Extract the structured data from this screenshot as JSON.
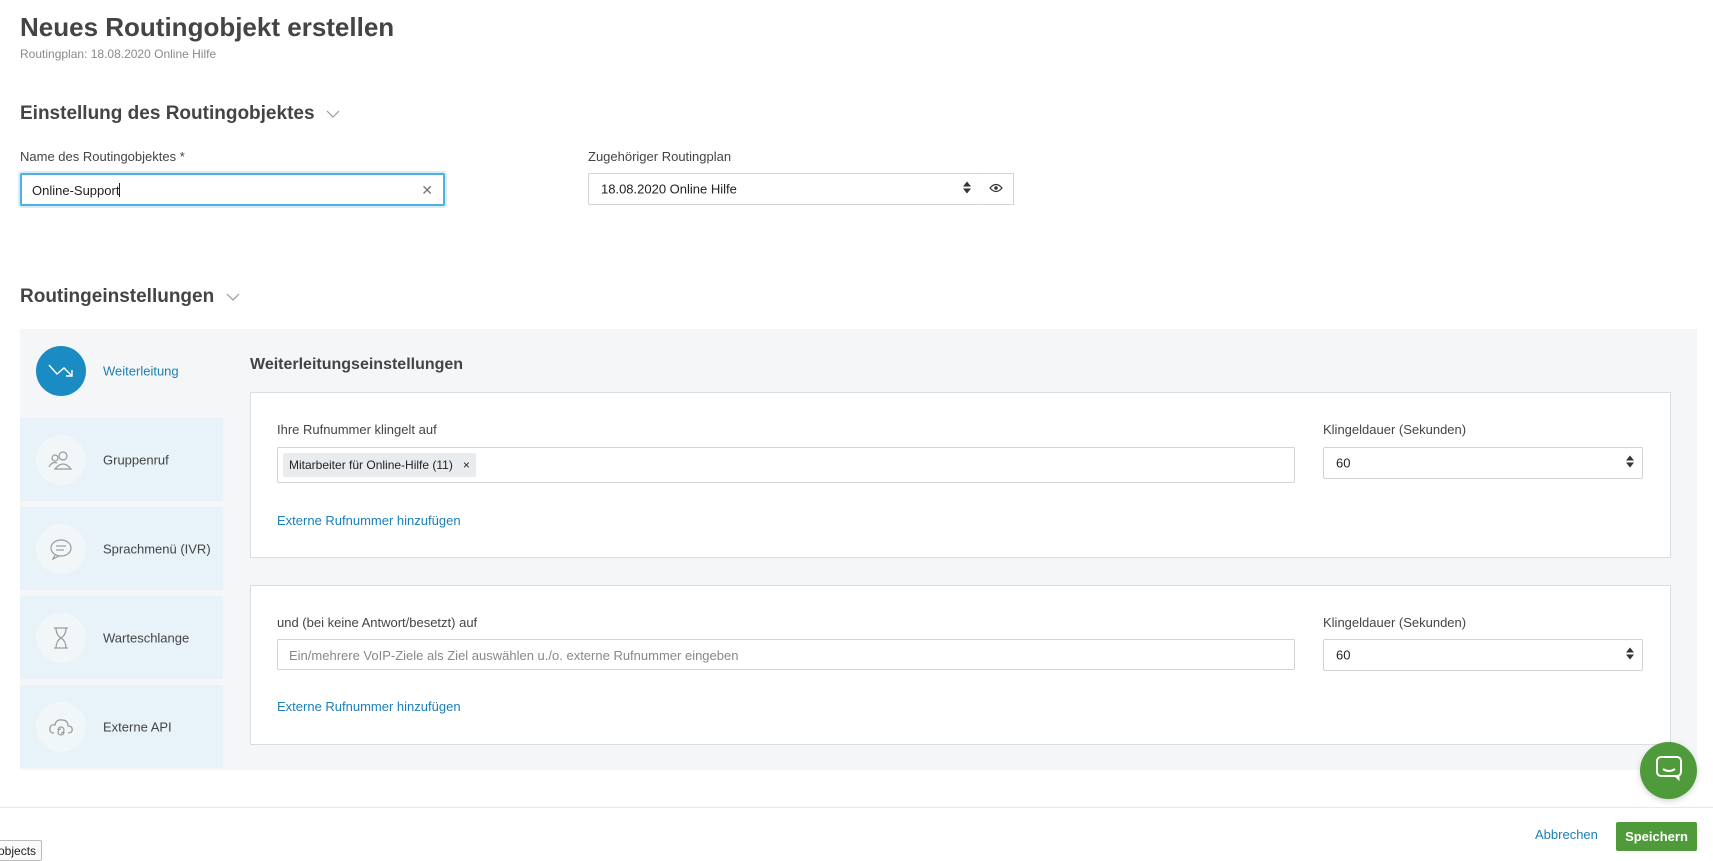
{
  "header": {
    "title": "Neues Routingobjekt erstellen",
    "subtitle": "Routingplan: 18.08.2020 Online Hilfe"
  },
  "settings_section": {
    "title": "Einstellung des Routingobjektes",
    "name_label": "Name des Routingobjektes *",
    "name_value": "Online-Support",
    "plan_label": "Zugehöriger Routingplan",
    "plan_value": "18.08.2020 Online Hilfe"
  },
  "routing_section": {
    "title": "Routingeinstellungen",
    "tabs": [
      {
        "label": "Weiterleitung",
        "icon": "forward-arrow-icon",
        "active": true
      },
      {
        "label": "Gruppenruf",
        "icon": "group-icon",
        "active": false
      },
      {
        "label": "Sprachmenü (IVR)",
        "icon": "speech-bubble-icon",
        "active": false
      },
      {
        "label": "Warteschlange",
        "icon": "hourglass-icon",
        "active": false
      },
      {
        "label": "Externe API",
        "icon": "cloud-sync-icon",
        "active": false
      }
    ]
  },
  "forwarding": {
    "title": "Weiterleitungseinstellungen",
    "primary": {
      "ring_label": "Ihre Rufnummer klingelt auf",
      "tag": "Mitarbeiter für Online-Hilfe (11)",
      "tag_remove": "×",
      "duration_label": "Klingeldauer (Sekunden)",
      "duration_value": "60",
      "add_link": "Externe Rufnummer hinzufügen"
    },
    "fallback": {
      "ring_label": "und (bei keine Antwort/besetzt) auf",
      "placeholder": "Ein/mehrere VoIP-Ziele als Ziel auswählen u./o. externe Rufnummer eingeben",
      "duration_label": "Klingeldauer (Sekunden)",
      "duration_value": "60",
      "add_link": "Externe Rufnummer hinzufügen"
    }
  },
  "footer": {
    "cancel_label": "Abbrechen",
    "save_label": "Speichern"
  },
  "tooltip": "objects",
  "colors": {
    "accent": "#1b8bc4",
    "link": "#1b7fb8",
    "save": "#4f9a3a",
    "tab_bg": "#e7f3f8",
    "panel_bg": "#f4f6f8"
  }
}
